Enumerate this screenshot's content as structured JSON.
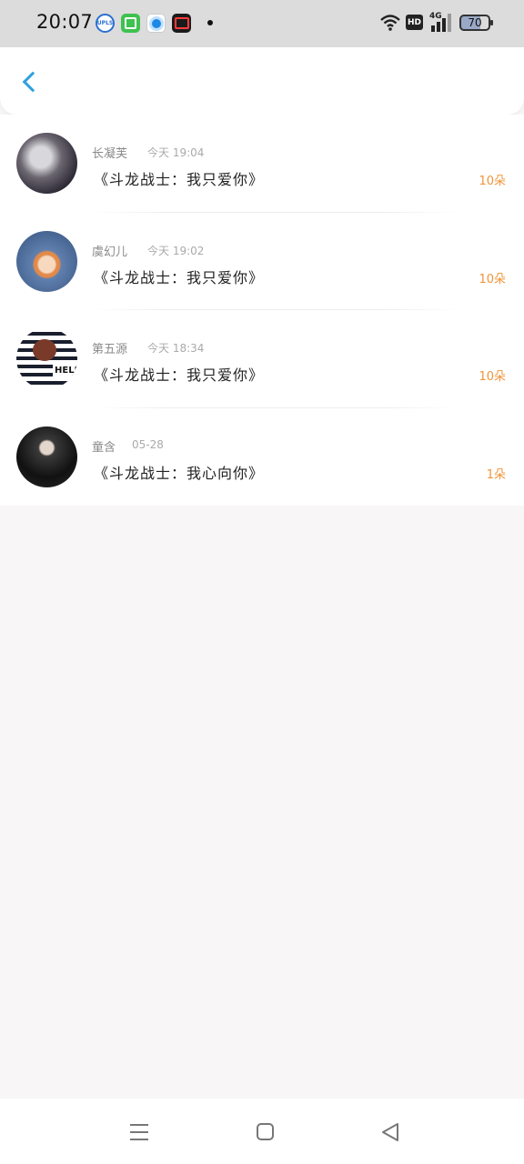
{
  "status_bar": {
    "time": "20:07",
    "notification_icons": [
      "uplus-app-icon",
      "green-app-icon",
      "blue-circle-app-icon",
      "video-app-icon"
    ],
    "network_label": "4G",
    "hd_label": "HD",
    "battery": "70"
  },
  "header": {
    "back_icon": "chevron-left-icon"
  },
  "gifts": [
    {
      "name": "长凝芙",
      "time": "今天 19:04",
      "title": "《斗龙战士：我只爱你》",
      "count": "10朵"
    },
    {
      "name": "虞幻儿",
      "time": "今天 19:02",
      "title": "《斗龙战士：我只爱你》",
      "count": "10朵"
    },
    {
      "name": "第五源",
      "time": "今天 18:34",
      "title": "《斗龙战士：我只爱你》",
      "count": "10朵"
    },
    {
      "name": "童含",
      "time": "05-28",
      "title": "《斗龙战士：我心向你》",
      "count": "1朵"
    }
  ],
  "colors": {
    "accent": "#2ea0e0",
    "count": "#f0943a",
    "background": "#f8f6f7"
  },
  "nav_bar": {
    "icons": [
      "menu-icon",
      "home-icon",
      "back-triangle-icon"
    ]
  }
}
